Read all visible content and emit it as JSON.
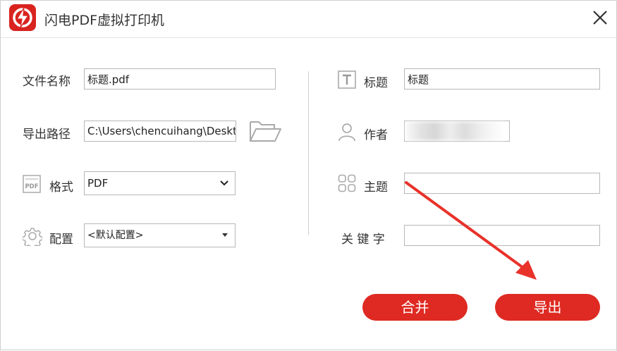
{
  "window": {
    "title": "闪电PDF虚拟打印机"
  },
  "left": {
    "filename_label": "文件名称",
    "filename_value": "标题.pdf",
    "path_label": "导出路径",
    "path_value": "C:\\Users\\chencuihang\\Desktop",
    "format_label": "格式",
    "format_value": "PDF",
    "config_label": "配置",
    "config_value": "<默认配置>"
  },
  "right": {
    "title_label": "标题",
    "title_value": "标题",
    "author_label": "作者",
    "author_value": "",
    "subject_label": "主题",
    "subject_value": "",
    "keyword_label": "关 键 字",
    "keyword_value": ""
  },
  "buttons": {
    "merge": "合并",
    "export": "导出"
  },
  "colors": {
    "accent": "#de2a22",
    "annotation_arrow": "#e8322a"
  }
}
